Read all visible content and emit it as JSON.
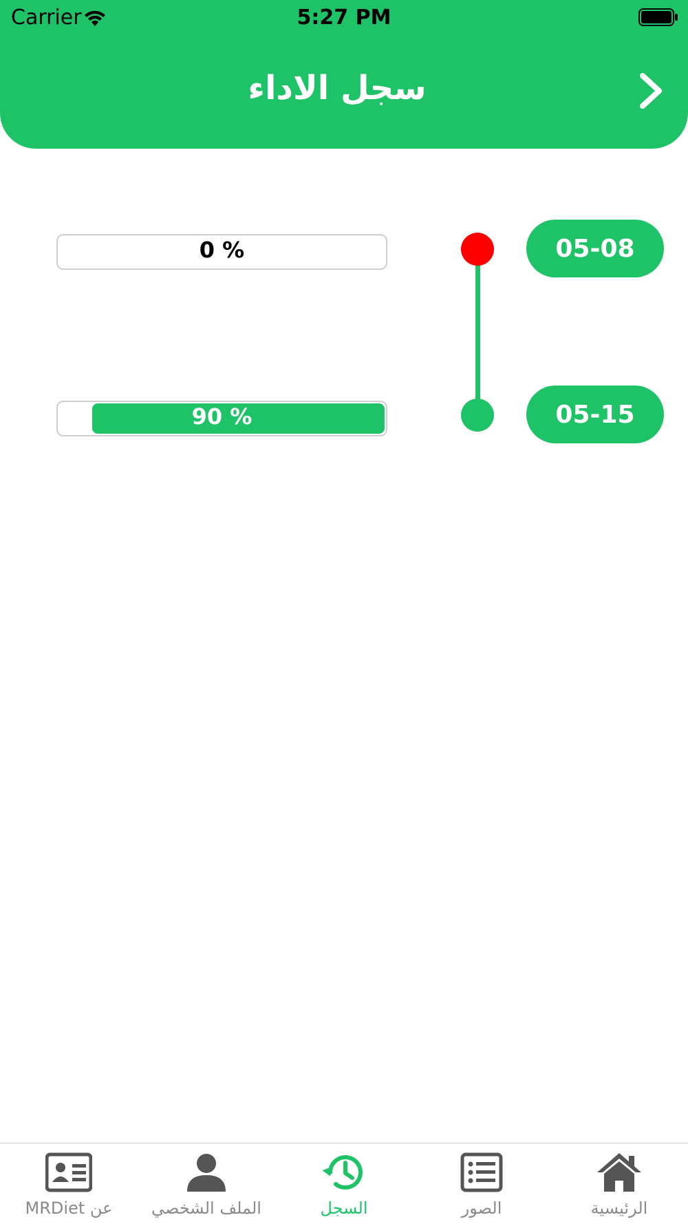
{
  "status_bar": {
    "carrier": "Carrier",
    "time": "5:27 PM"
  },
  "header": {
    "title": "سجل الاداء"
  },
  "timeline": [
    {
      "date": "05-08",
      "progress_label": "0 %",
      "progress": 0.0,
      "dot_color": "#ff0000",
      "label_color": "#000000"
    },
    {
      "date": "05-15",
      "progress_label": "90 %",
      "progress": 0.9,
      "dot_color": "#1fc367",
      "label_color": "#ffffff"
    }
  ],
  "tab_bar": {
    "active": "tab-history",
    "items": [
      {
        "id": "tab-about",
        "label": "عن MRDiet",
        "icon": "id-card-icon"
      },
      {
        "id": "tab-profile",
        "label": "الملف الشخصي",
        "icon": "user-icon"
      },
      {
        "id": "tab-history",
        "label": "السجل",
        "icon": "history-icon"
      },
      {
        "id": "tab-photos",
        "label": "الصور",
        "icon": "list-icon"
      },
      {
        "id": "tab-home",
        "label": "الرئيسية",
        "icon": "home-icon"
      }
    ]
  },
  "colors": {
    "accent": "#1fc367",
    "inactive": "#555555",
    "alert": "#ff0000"
  }
}
